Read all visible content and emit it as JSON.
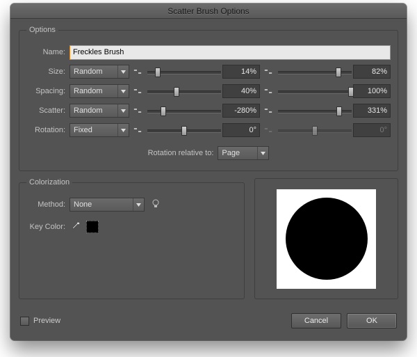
{
  "window": {
    "title": "Scatter Brush Options"
  },
  "options": {
    "legend": "Options",
    "name": {
      "label": "Name:",
      "value": "Freckles Brush"
    },
    "rows": [
      {
        "label": "Size:",
        "mode": "Random",
        "v1": "14%",
        "v2": "82%"
      },
      {
        "label": "Spacing:",
        "mode": "Random",
        "v1": "40%",
        "v2": "100%"
      },
      {
        "label": "Scatter:",
        "mode": "Random",
        "v1": "-280%",
        "v2": "331%"
      },
      {
        "label": "Rotation:",
        "mode": "Fixed",
        "v1": "0°",
        "v2": "0°"
      }
    ],
    "rotation_relative": {
      "label": "Rotation relative to:",
      "value": "Page"
    }
  },
  "colorization": {
    "legend": "Colorization",
    "method": {
      "label": "Method:",
      "value": "None"
    },
    "key_color": {
      "label": "Key Color:",
      "swatch": "#000000"
    }
  },
  "footer": {
    "preview_label": "Preview",
    "cancel": "Cancel",
    "ok": "OK"
  }
}
